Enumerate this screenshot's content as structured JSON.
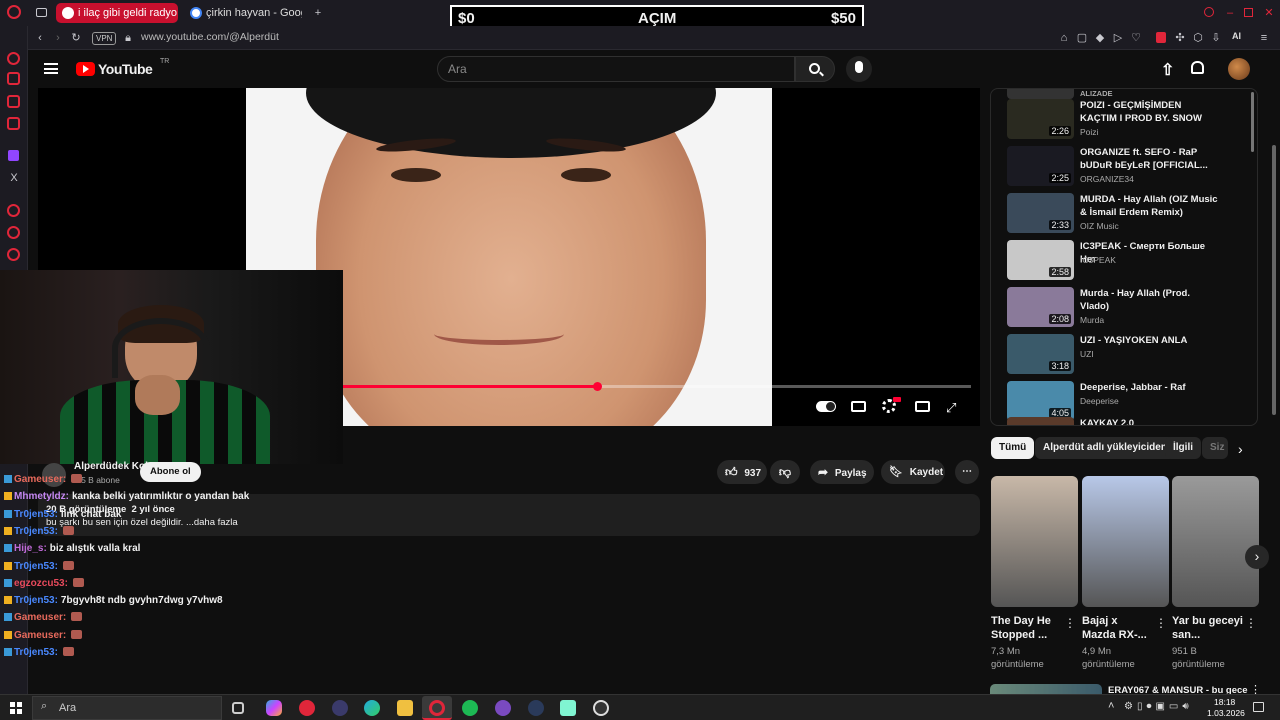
{
  "browser": {
    "tabs": [
      {
        "label": "i ilaç gibi geldi radyo..."
      },
      {
        "label": "çirkin hayvan - Google Se..."
      }
    ],
    "address": "www.youtube.com/@Alperdüt",
    "vpn_label": "VPN",
    "ai_label": "AI"
  },
  "overlay": {
    "left": "$0",
    "center": "AÇIM",
    "right": "$50"
  },
  "youtube": {
    "logo_text": "YouTube",
    "region": "TR",
    "search_placeholder": "Ara"
  },
  "video": {
    "progress": 0.405
  },
  "channel": {
    "name": "Alperdüdek Koku...",
    "subscribers": "9.5 B abone",
    "subscribe_label": "Abone ol",
    "views_line": "20 B görüntüleme  2 yıl önce",
    "description_line": "bu şarkı bu sen için özel değildir. ...daha fazla",
    "likes": "937",
    "share_label": "Paylaş",
    "save_label": "Kaydet"
  },
  "chat": [
    {
      "user": "Gameuser:",
      "color": "#e86a5c",
      "text": "",
      "emote": true
    },
    {
      "user": "Mhmetyldz:",
      "color": "#c587f2",
      "text": "kanka belki yatırımlıktır o yandan bak",
      "emote": false
    },
    {
      "user": "Tr0jen53:",
      "color": "#4a89ff",
      "text": "link chat bak",
      "emote": false
    },
    {
      "user": "Tr0jen53:",
      "color": "#4a89ff",
      "text": "",
      "emote": true
    },
    {
      "user": "Hije_s:",
      "color": "#c06ad8",
      "text": "biz alıştık valla kral",
      "emote": false
    },
    {
      "user": "Tr0jen53:",
      "color": "#4a89ff",
      "text": "",
      "emote": true
    },
    {
      "user": "egzozcu53:",
      "color": "#e84a5c",
      "text": "",
      "emote": true
    },
    {
      "user": "Tr0jen53:",
      "color": "#4a89ff",
      "text": "7bgyvh8t ndb gvyhn7dwg y7vhw8",
      "emote": false
    },
    {
      "user": "Gameuser:",
      "color": "#e86a5c",
      "text": "",
      "emote": true
    },
    {
      "user": "Gameuser:",
      "color": "#e86a5c",
      "text": "",
      "emote": true
    },
    {
      "user": "Tr0jen53:",
      "color": "#4a89ff",
      "text": "",
      "emote": true
    }
  ],
  "related": [
    {
      "title": "ALIZADE",
      "channel": "",
      "duration": "",
      "thumb": "#333"
    },
    {
      "title": "POIZI - GEÇMİŞİMDEN KAÇTIM I PROD BY. SNOW",
      "channel": "Poizi",
      "duration": "2:26",
      "thumb": "#2a2a20"
    },
    {
      "title": "ORGANIZE ft. SEFO - RaP bUDuR bEyLeR [OFFICIAL...",
      "channel": "ORGANIZE34",
      "duration": "2:25",
      "thumb": "#1a1a22"
    },
    {
      "title": "MURDA - Hay Allah (OIZ Music & İsmail Erdem Remix)",
      "channel": "OIZ Music",
      "duration": "2:33",
      "thumb": "#3a4a5a"
    },
    {
      "title": "IC3PEAK - Смерти Больше Нет",
      "channel": "IC3PEAK",
      "duration": "2:58",
      "thumb": "#c8c8c8"
    },
    {
      "title": "Murda - Hay Allah (Prod. Vlado)",
      "channel": "Murda",
      "duration": "2:08",
      "thumb": "#8a7a9a"
    },
    {
      "title": "UZI - YAŞIYOKEN ANLA",
      "channel": "UZI",
      "duration": "3:18",
      "thumb": "#3a5a6a"
    },
    {
      "title": "Deeperise, Jabbar - Raf",
      "channel": "Deeperise",
      "duration": "4:05",
      "thumb": "#4a8aaa"
    },
    {
      "title": "KAYKAY 2.0",
      "channel": "",
      "duration": "",
      "thumb": "#5a3a2a"
    }
  ],
  "chips": [
    "Tümü",
    "Alperdüt adlı yükleyiciden",
    "İlgili",
    "Siz"
  ],
  "shorts": [
    {
      "title": "The Day He Stopped ...",
      "meta": "7,3 Mn görüntüleme",
      "thumb": "#c8b8a8"
    },
    {
      "title": "Bajaj x Mazda RX-...",
      "meta": "4,9 Mn görüntüleme",
      "thumb": "#b8c8e8"
    },
    {
      "title": "Yar bu geceyi san...",
      "meta": "951 B görüntüleme",
      "thumb": "#9a9a9a"
    }
  ],
  "next_item_title": "ERAY067 & MANSUR - bu gece",
  "taskbar": {
    "search_placeholder": "Ara",
    "time": "18:18",
    "date": "1.03.2026"
  }
}
